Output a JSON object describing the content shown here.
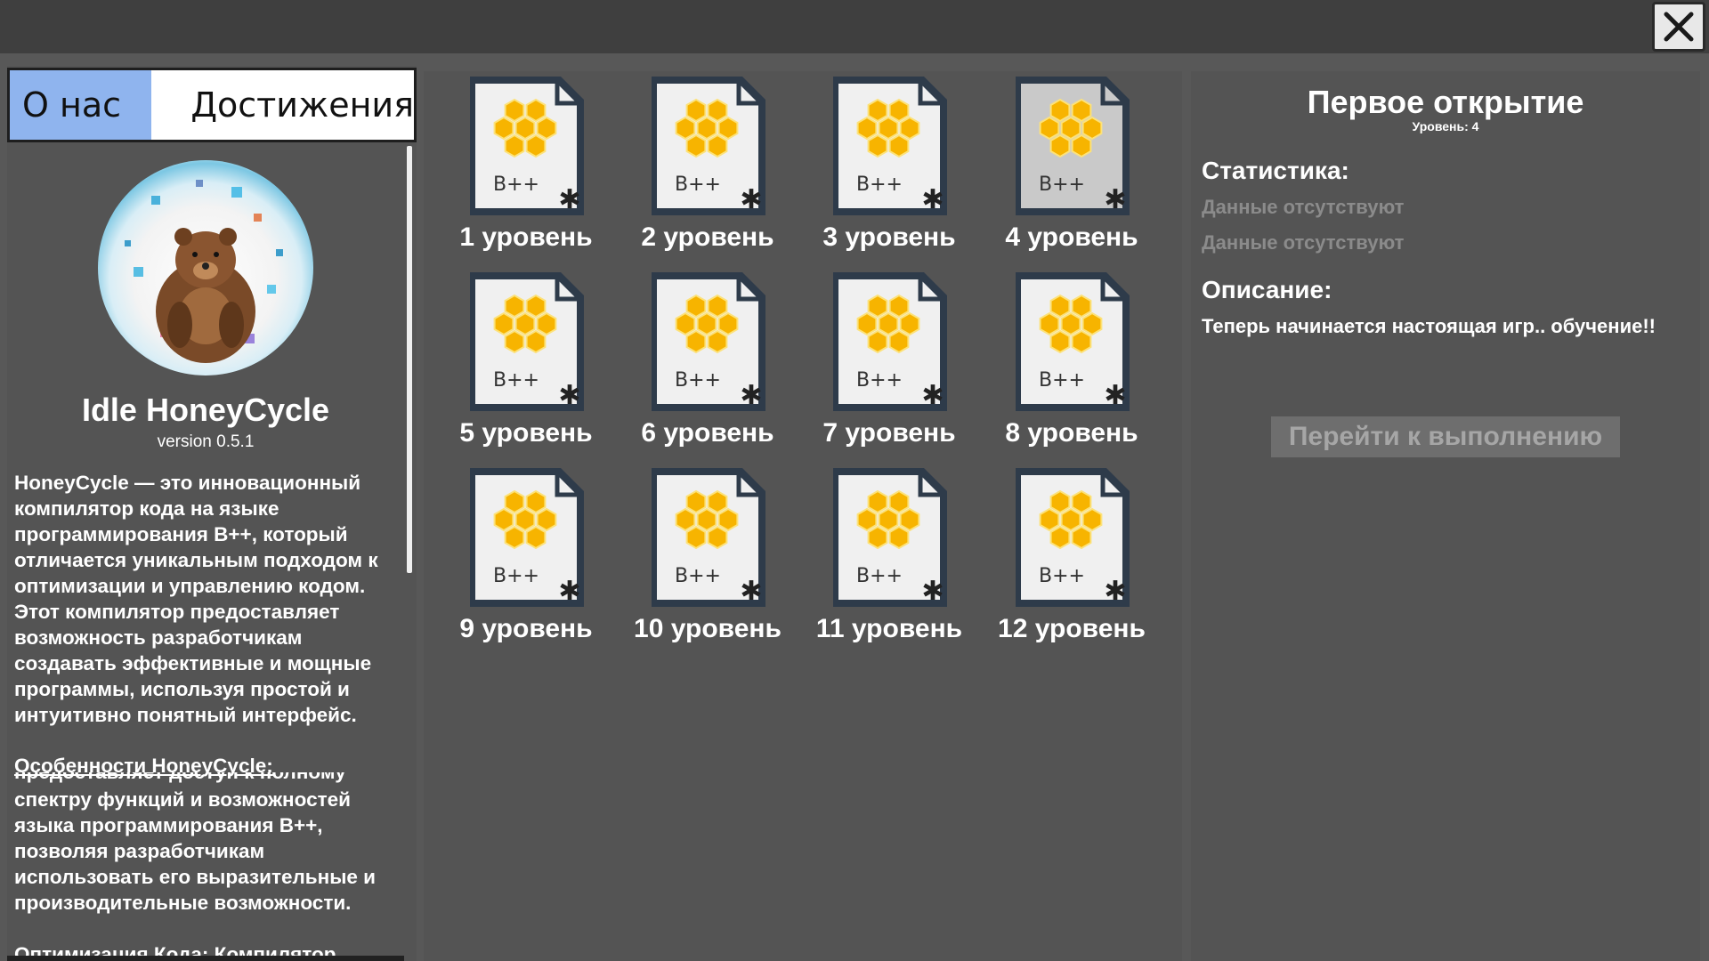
{
  "window": {
    "close_icon": "close-icon"
  },
  "left_panel": {
    "tabs": [
      {
        "label": "О нас",
        "active": true
      },
      {
        "label": "Достижения",
        "active": false
      }
    ],
    "app_name": "Idle HoneyCycle",
    "version": "version 0.5.1",
    "about_p1": "HoneyCycle — это инновационный\nкомпилятор кода на языке\nпрограммирования B++, который\nотличается уникальным подходом к\nоптимизации и управлению кодом.\nЭтот компилятор предоставляет\nвозможность разработчикам\nсоздавать эффективные и мощные\nпрограммы, используя простой и\nинтуитивно понятный интерфейс.",
    "features_heading": "Особенности HoneyCycle:",
    "about_overlap": "предоставляет доступ к полному",
    "about_p2": "спектру функций и возможностей\nязыка программирования B++,\nпозволяя разработчикам\nиспользовать его выразительные и\nпроизводительные возможности.",
    "about_p3": "Оптимизация Кода: Компилятор"
  },
  "levels": [
    {
      "caption": "1 уровень",
      "file_label": "B++"
    },
    {
      "caption": "2 уровень",
      "file_label": "B++"
    },
    {
      "caption": "3 уровень",
      "file_label": "B++"
    },
    {
      "caption": "4 уровень",
      "file_label": "B++",
      "selected": true
    },
    {
      "caption": "5 уровень",
      "file_label": "B++"
    },
    {
      "caption": "6 уровень",
      "file_label": "B++"
    },
    {
      "caption": "7 уровень",
      "file_label": "B++"
    },
    {
      "caption": "8 уровень",
      "file_label": "B++"
    },
    {
      "caption": "9 уровень",
      "file_label": "B++"
    },
    {
      "caption": "10 уровень",
      "file_label": "B++"
    },
    {
      "caption": "11 уровень",
      "file_label": "B++"
    },
    {
      "caption": "12 уровень",
      "file_label": "B++"
    }
  ],
  "achievement": {
    "title": "Первое открытие",
    "level": "Уровень: 4",
    "stats_heading": "Статистика:",
    "stats": [
      "Данные отсутствуют",
      "Данные отсутствуют"
    ],
    "desc_heading": "Описание:",
    "description": "Теперь начинается настоящая игр.. обучение!!",
    "action_button": "Перейти к выполнению"
  },
  "colors": {
    "background": "#585858",
    "topbar": "#3f3f3f",
    "panel": "#545454",
    "active_tab": "#8fb4ee",
    "honey": "#f7b400",
    "muted_text": "#8b8b8b"
  }
}
